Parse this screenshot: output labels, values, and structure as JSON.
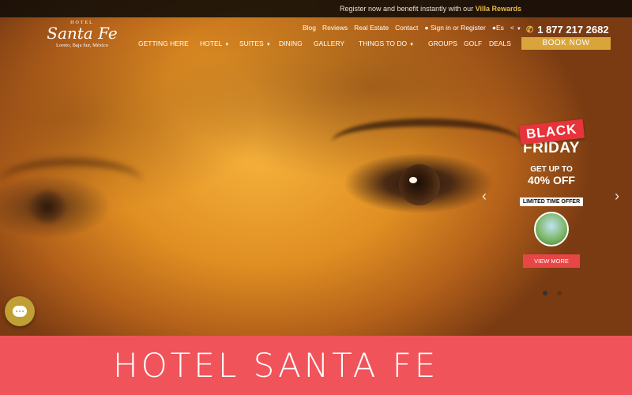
{
  "topbar": {
    "text": "Register now and benefit instantly with our",
    "highlight": "Villa Rewards"
  },
  "logo": {
    "small": "HOTEL",
    "name": "Santa Fe",
    "location": "Loreto, Baja Sur, México"
  },
  "subnav": {
    "blog": "Blog",
    "reviews": "Reviews",
    "real_estate": "Real Estate",
    "contact": "Contact",
    "signin": "Sign in or Register",
    "language": "Es"
  },
  "phone": "1 877 217 2682",
  "mainnav": [
    "GETTING HERE",
    "HOTEL",
    "SUITES",
    "DINING",
    "GALLERY",
    "THINGS TO DO",
    "GROUPS",
    "GOLF",
    "DEALS"
  ],
  "book": "BOOK NOW",
  "promo": {
    "black": "BLACK",
    "friday": "FRIDAY",
    "getup": "GET UP TO",
    "pct": "40% OFF",
    "limited": "LIMITED TIME OFFER",
    "viewmore": "VIEW MORE"
  },
  "banner": "HOTEL SANTA FE",
  "colors": {
    "accent": "#d9a43a",
    "banner": "#f0545a",
    "promo_red": "#e8333a"
  }
}
